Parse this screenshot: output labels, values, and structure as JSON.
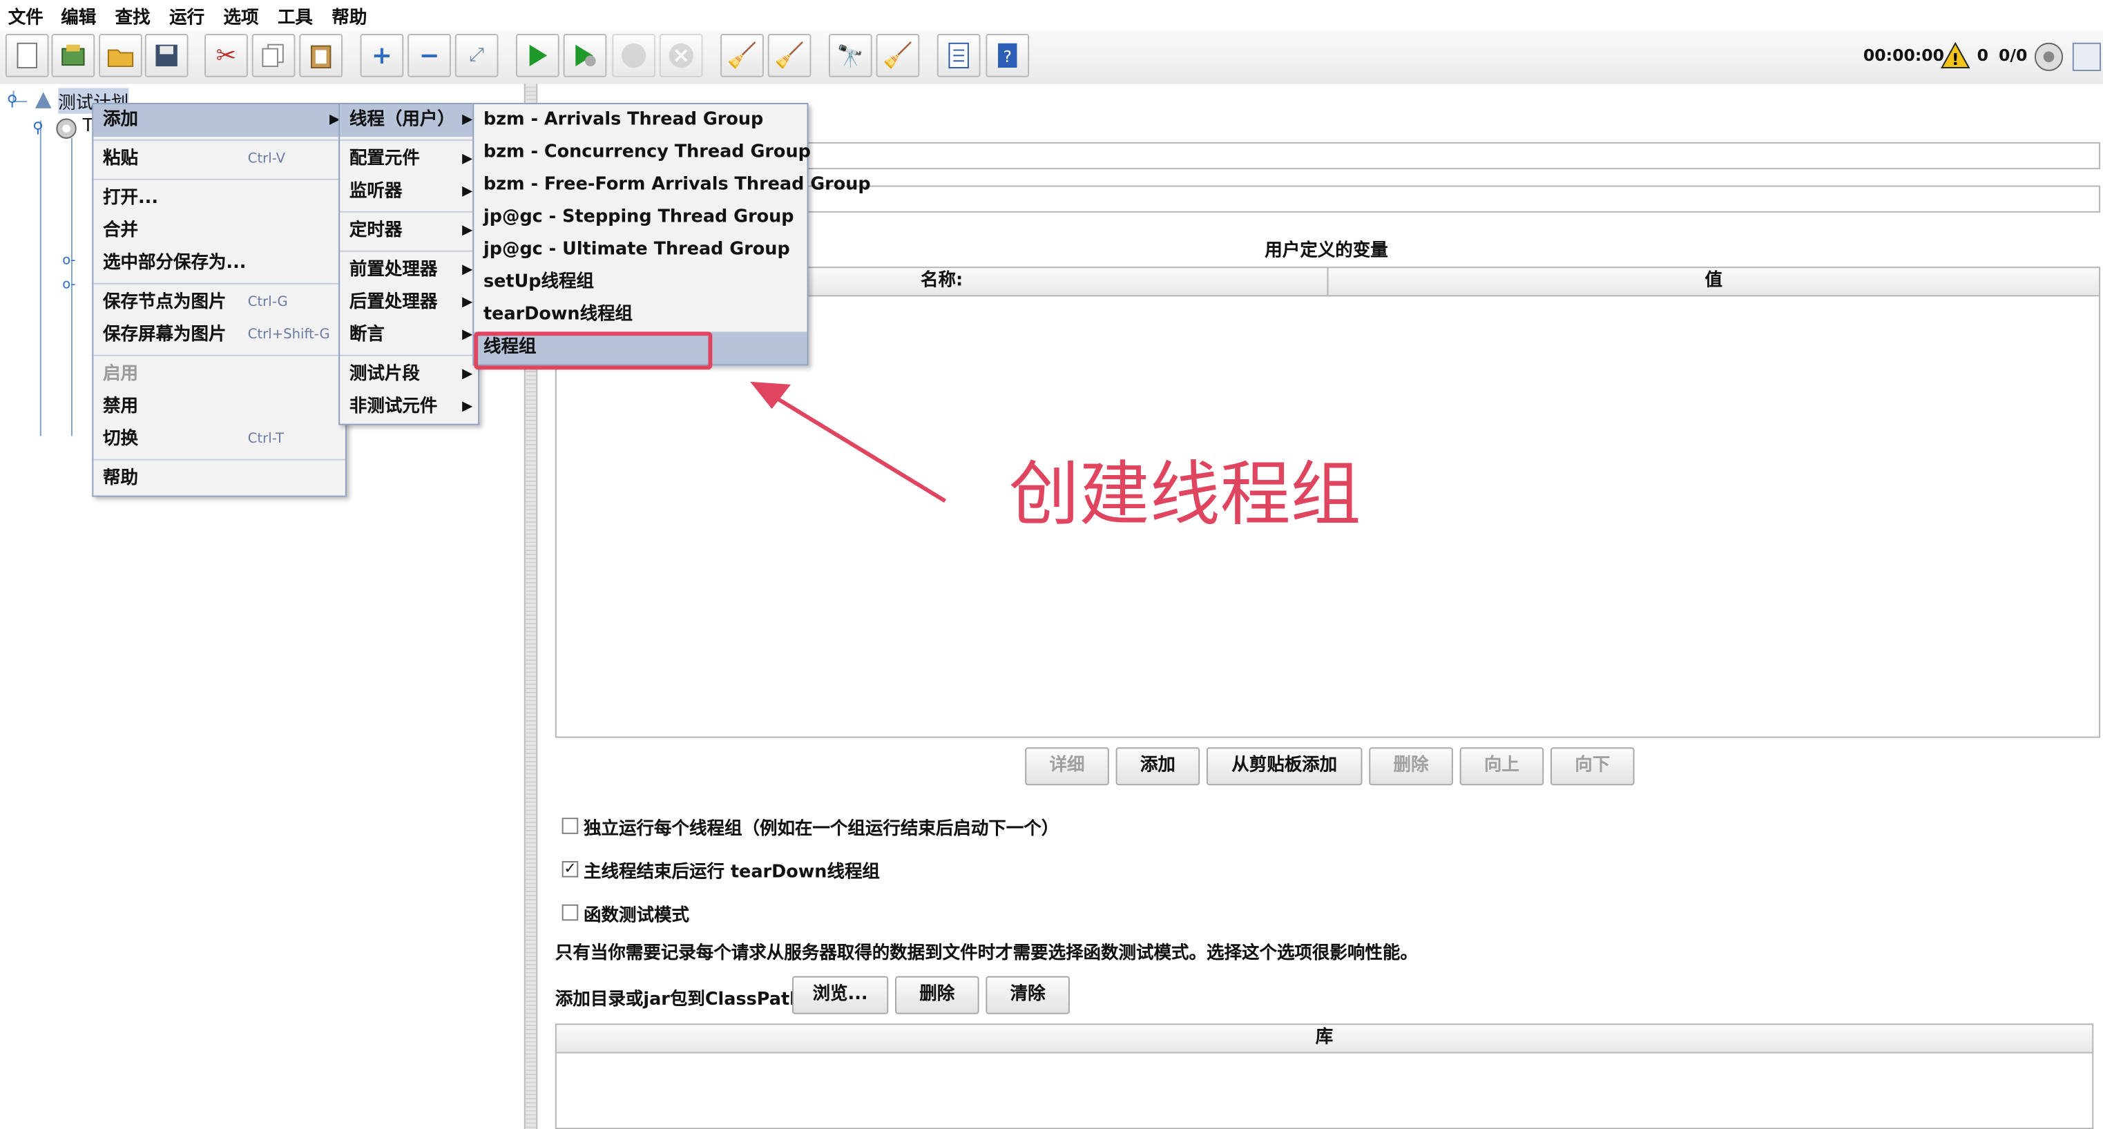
{
  "menubar": [
    "文件",
    "编辑",
    "查找",
    "运行",
    "选项",
    "工具",
    "帮助"
  ],
  "toolbar": {
    "timer": "00:00:00",
    "warn_count": "0",
    "threads": "0/0"
  },
  "tree": {
    "root_label": "测试计划",
    "child_label": "T"
  },
  "context_menu": {
    "items": [
      {
        "label": "添加",
        "submenu": true
      },
      {
        "label": "粘贴",
        "accel": "Ctrl-V"
      },
      {
        "label": "打开..."
      },
      {
        "label": "合并"
      },
      {
        "label": "选中部分保存为..."
      },
      {
        "label": "保存节点为图片",
        "accel": "Ctrl-G"
      },
      {
        "label": "保存屏幕为图片",
        "accel": "Ctrl+Shift-G"
      },
      {
        "label": "启用"
      },
      {
        "label": "禁用"
      },
      {
        "label": "切换",
        "accel": "Ctrl-T"
      },
      {
        "label": "帮助"
      }
    ]
  },
  "add_menu": {
    "items": [
      "线程（用户）",
      "配置元件",
      "监听器",
      "定时器",
      "前置处理器",
      "后置处理器",
      "断言",
      "测试片段",
      "非测试元件"
    ]
  },
  "thread_menu": {
    "items": [
      "bzm - Arrivals Thread Group",
      "bzm - Concurrency Thread Group",
      "bzm - Free-Form Arrivals Thread Group",
      "jp@gc - Stepping Thread Group",
      "jp@gc - Ultimate Thread Group",
      "setUp线程组",
      "tearDown线程组",
      "线程组"
    ]
  },
  "annotation": {
    "text": "创建线程组",
    "color": "#e0455f"
  },
  "panel": {
    "vars_title": "用户定义的变量",
    "col_name": "名称:",
    "col_value": "值",
    "buttons": [
      "详细",
      "添加",
      "从剪贴板添加",
      "删除",
      "向上",
      "向下"
    ],
    "opt_independent": "独立运行每个线程组（例如在一个组运行结束后启动下一个）",
    "opt_teardown": "主线程结束后运行 tearDown线程组",
    "opt_functional": "函数测试模式",
    "functional_note": "只有当你需要记录每个请求从服务器取得的数据到文件时才需要选择函数测试模式。选择这个选项很影响性能。",
    "classpath_label": "添加目录或jar包到ClassPath",
    "cp_buttons": [
      "浏览...",
      "删除",
      "清除"
    ],
    "lib_header": "库"
  }
}
